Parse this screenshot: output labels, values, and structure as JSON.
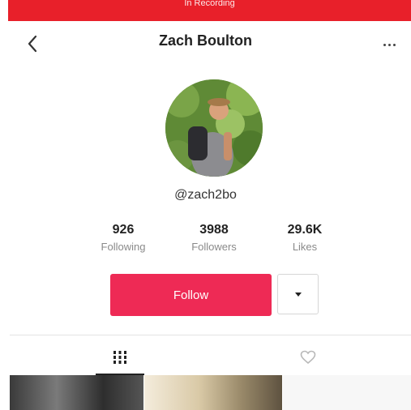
{
  "status_bar": {
    "text": "In Recording"
  },
  "header": {
    "title": "Zach Boulton"
  },
  "profile": {
    "username": "@zach2bo",
    "stats": [
      {
        "value": "926",
        "label": "Following"
      },
      {
        "value": "3988",
        "label": "Followers"
      },
      {
        "value": "29.6K",
        "label": "Likes"
      }
    ]
  },
  "actions": {
    "follow_label": "Follow"
  },
  "colors": {
    "status_bar": "#e8202a",
    "follow_button": "#ee2a55"
  },
  "icons": {
    "back": "chevron-left-icon",
    "more": "more-horizontal-icon",
    "dropdown": "caret-down-icon",
    "videos_tab": "grid-icon",
    "liked_tab": "heart-outline-icon"
  }
}
